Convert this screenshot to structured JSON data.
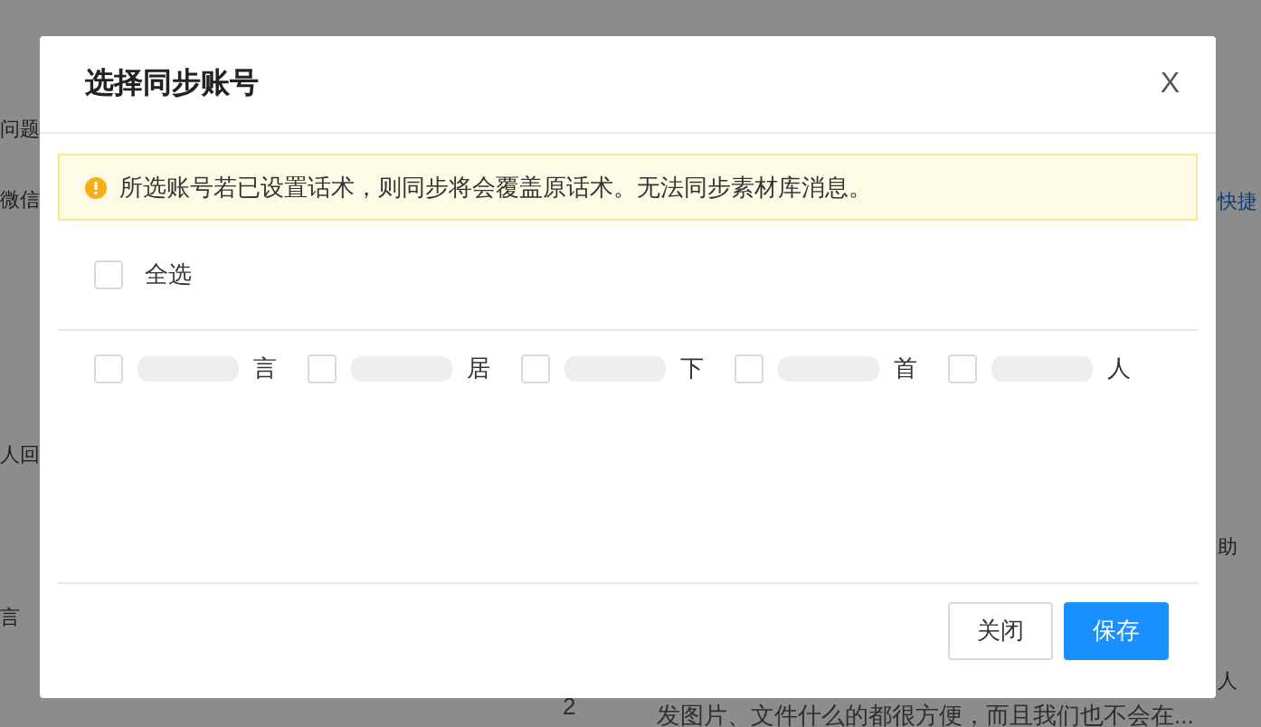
{
  "background": {
    "left_texts": [
      "问题",
      "微信",
      "人回",
      "言"
    ],
    "right_texts": [
      "快捷",
      "助",
      "人"
    ],
    "row_number": "2",
    "row_text": "发图片、文件什么的都很方便，而且我们也不会在..."
  },
  "dialog": {
    "title": "选择同步账号",
    "close": "X",
    "alert": "所选账号若已设置话术，则同步将会覆盖原话术。无法同步素材库消息。",
    "select_all": {
      "label": "全选",
      "checked": false
    },
    "accounts": [
      {
        "label": "言",
        "checked": false
      },
      {
        "label": "居",
        "checked": false
      },
      {
        "label": "下",
        "checked": false
      },
      {
        "label": "首",
        "checked": false
      },
      {
        "label": "人",
        "checked": false
      }
    ],
    "buttons": [
      {
        "label": "关闭",
        "kind": "default"
      },
      {
        "label": "保存",
        "kind": "primary"
      }
    ]
  }
}
